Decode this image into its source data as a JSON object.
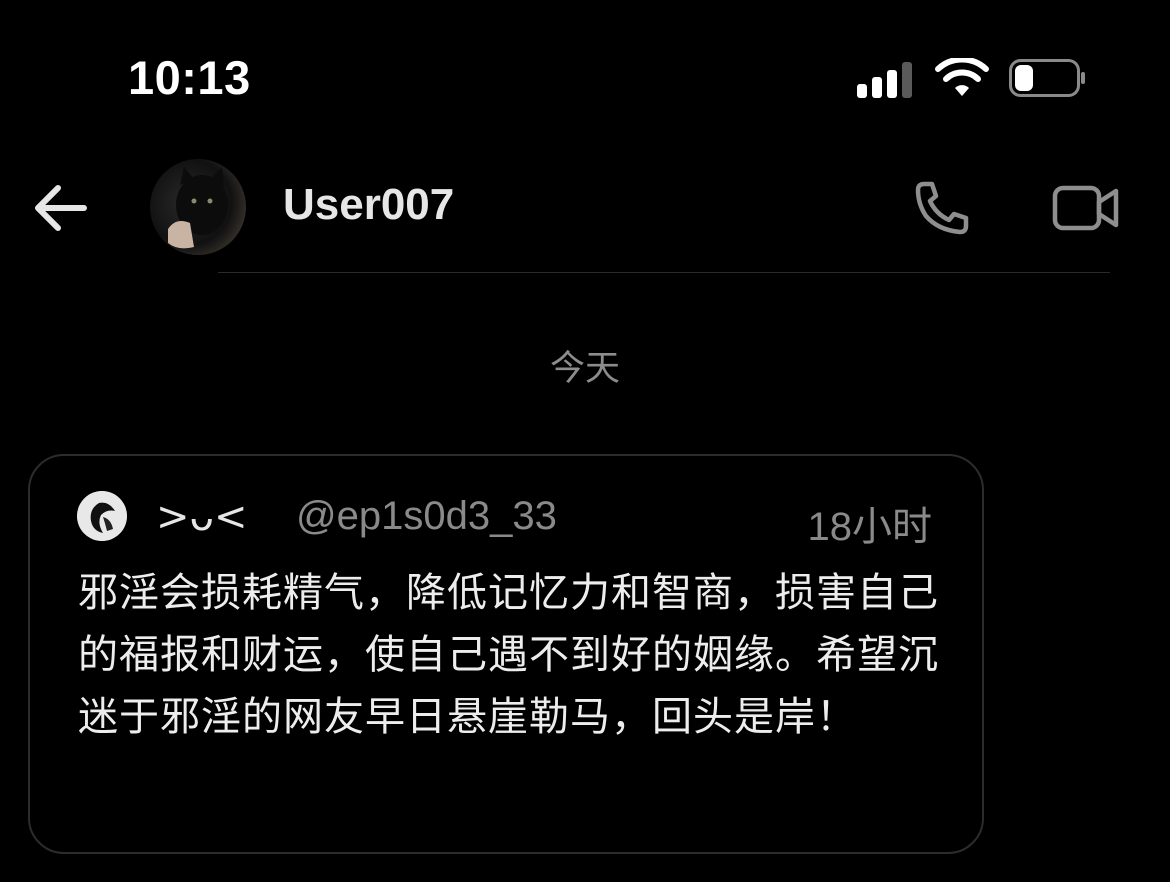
{
  "status_bar": {
    "time": "10:13",
    "icons": [
      "cellular-signal-icon",
      "wifi-icon",
      "battery-icon"
    ],
    "battery_level": 0.3
  },
  "header": {
    "back_icon": "arrow-left-icon",
    "username": "User007",
    "call_icon": "phone-icon",
    "video_icon": "video-camera-icon"
  },
  "conversation": {
    "date_separator": "今天"
  },
  "shared_post": {
    "author_name": ">ᴗ<",
    "author_handle": "@ep1s0d3_33",
    "time_ago": "18小时",
    "text": "邪淫会损耗精气，降低记忆力和智商，损害自己的福报和财运，使自己遇不到好的姻缘。希望沉迷于邪淫的网友早日悬崖勒马，回头是岸！"
  },
  "colors": {
    "background": "#000000",
    "primary_text": "#e6e6e6",
    "secondary_text": "#8a8a8a",
    "card_border": "#2c2c2c",
    "icon_gray": "#8e8e8e"
  }
}
